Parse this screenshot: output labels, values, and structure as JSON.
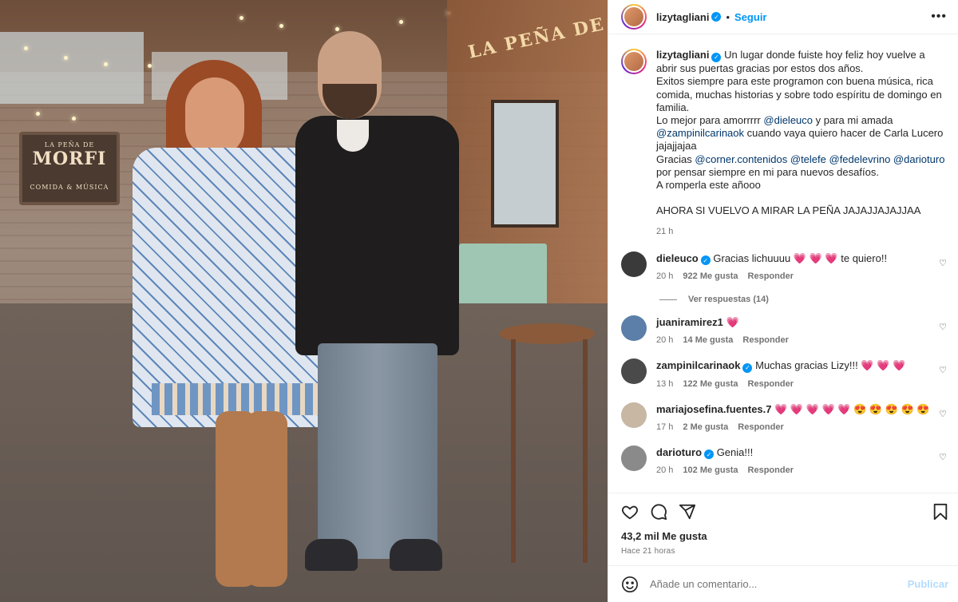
{
  "post": {
    "author": {
      "username": "lizytagliani",
      "follow_label": "Seguir",
      "separator": "•",
      "more_icon": "more-horizontal-icon"
    },
    "photo": {
      "sign_small": "LA PEÑA DE",
      "sign_big": "MORFI",
      "sign_sub": "COMIDA & MÚSICA",
      "wall_text": "LA PEÑA DE"
    },
    "caption": {
      "username": "lizytagliani",
      "lines": [
        "Un lugar donde fuiste hoy feliz hoy vuelve a abrir sus puertas gracias por estos dos años.",
        "Exitos siempre para este programon con buena música, rica comida, muchas historias y sobre todo espíritu de domingo en familia.",
        "Lo mejor para amorrrrr",
        "@dieleuco",
        "y para mi amada",
        "@zampinilcarinaok",
        "cuando vaya quiero hacer de Carla Lucero jajajjajaa",
        "Gracias",
        "@corner.contenidos",
        "@telefe",
        "@fedelevrino",
        "@darioturo",
        "por pensar siempre en mi para nuevos desafíos.",
        "A romperla este añooo",
        "AHORA SI VUELVO A MIRAR LA PEÑA JAJAJJAJAJJAA"
      ],
      "time": "21 h"
    },
    "comments": [
      {
        "username": "dieleuco",
        "verified": true,
        "text": "Gracias lichuuuu",
        "emojis": "💗 💗 💗",
        "text_after": "te quiero!!",
        "time": "20 h",
        "likes": "922 Me gusta",
        "reply": "Responder",
        "avatar_color": "#3a3a3a"
      },
      {
        "username": "juaniramirez1",
        "verified": false,
        "text": "",
        "emojis": "💗",
        "text_after": "",
        "time": "20 h",
        "likes": "14 Me gusta",
        "reply": "Responder",
        "avatar_color": "#5b7fa8"
      },
      {
        "username": "zampinilcarinaok",
        "verified": true,
        "text": "Muchas gracias Lizy!!!",
        "emojis": "💗 💗 💗",
        "text_after": "",
        "time": "13 h",
        "likes": "122 Me gusta",
        "reply": "Responder",
        "avatar_color": "#4a4a4a"
      },
      {
        "username": "mariajosefina.fuentes.7",
        "verified": false,
        "text": "",
        "emojis": "💗 💗 💗 💗 💗 😍 😍 😍 😍 😍",
        "text_after": "",
        "time": "17 h",
        "likes": "2 Me gusta",
        "reply": "Responder",
        "avatar_color": "#c7b7a3"
      },
      {
        "username": "darioturo",
        "verified": true,
        "text": "Genia!!!",
        "emojis": "",
        "text_after": "",
        "time": "20 h",
        "likes": "102 Me gusta",
        "reply": "Responder",
        "avatar_color": "#8a8a8a"
      }
    ],
    "view_replies": "Ver respuestas (14)",
    "likes": "43,2 mil Me gusta",
    "posted": "Hace 21 horas",
    "comment_placeholder": "Añade un comentario...",
    "publish_label": "Publicar",
    "colors": {
      "accent": "#0095f6",
      "mention": "#00376b",
      "muted": "#737373",
      "publish_disabled": "#b3dbff"
    }
  }
}
